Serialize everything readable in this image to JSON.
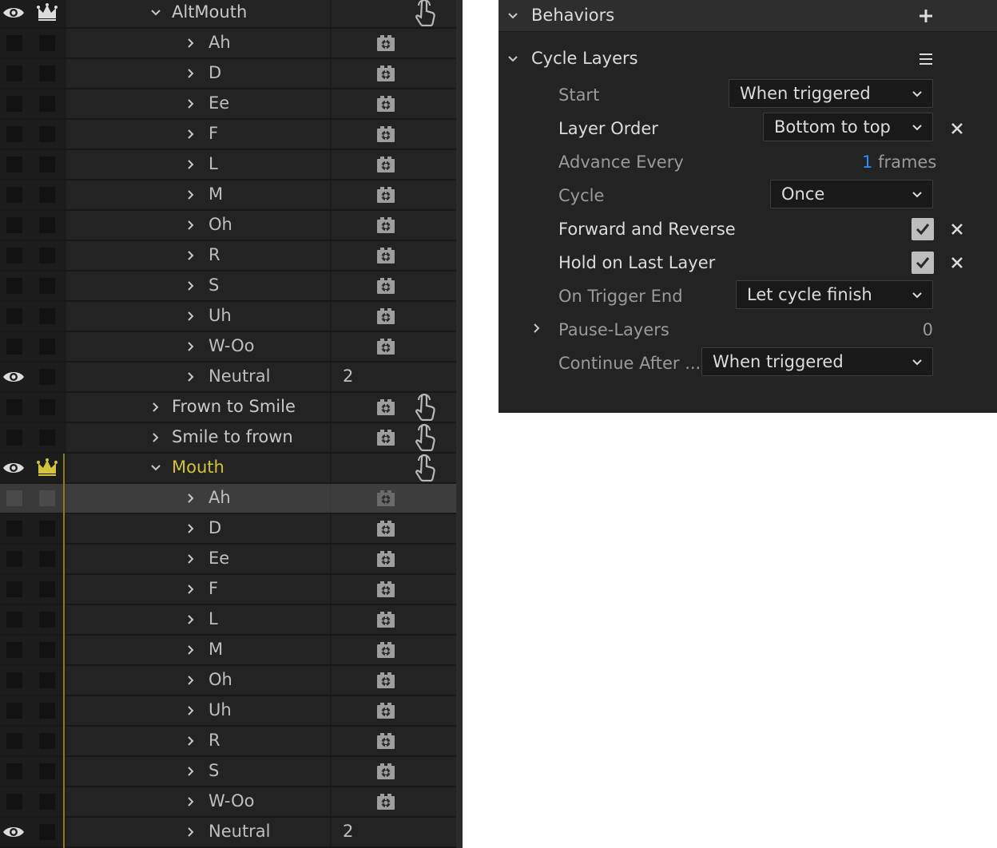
{
  "layers_panel": {
    "rows": [
      {
        "name": "AltMouth",
        "indent": 1,
        "expanded": true,
        "eye": true,
        "crown": true,
        "crown_gold": false,
        "gold": false,
        "cam": false,
        "hand": true
      },
      {
        "name": "Ah",
        "indent": 2,
        "cam": true
      },
      {
        "name": "D",
        "indent": 2,
        "cam": true
      },
      {
        "name": "Ee",
        "indent": 2,
        "cam": true
      },
      {
        "name": "F",
        "indent": 2,
        "cam": true
      },
      {
        "name": "L",
        "indent": 2,
        "cam": true
      },
      {
        "name": "M",
        "indent": 2,
        "cam": true
      },
      {
        "name": "Oh",
        "indent": 2,
        "cam": true
      },
      {
        "name": "R",
        "indent": 2,
        "cam": true
      },
      {
        "name": "S",
        "indent": 2,
        "cam": true
      },
      {
        "name": "Uh",
        "indent": 2,
        "cam": true
      },
      {
        "name": "W-Oo",
        "indent": 2,
        "cam": true
      },
      {
        "name": "Neutral",
        "indent": 2,
        "eye": true,
        "cam": false,
        "param": "2"
      },
      {
        "name": "Frown to Smile",
        "indent": 1,
        "cam": true,
        "hand": true
      },
      {
        "name": "Smile to frown",
        "indent": 1,
        "cam": true,
        "hand": true
      },
      {
        "name": "Mouth",
        "indent": 1,
        "expanded": true,
        "eye": true,
        "crown": true,
        "crown_gold": true,
        "gold": true,
        "cam": false,
        "hand": true,
        "goldline": true
      },
      {
        "name": "Ah",
        "indent": 2,
        "cam": true,
        "selected": true,
        "goldline": true
      },
      {
        "name": "D",
        "indent": 2,
        "cam": true,
        "goldline": true
      },
      {
        "name": "Ee",
        "indent": 2,
        "cam": true,
        "goldline": true
      },
      {
        "name": "F",
        "indent": 2,
        "cam": true,
        "goldline": true
      },
      {
        "name": "L",
        "indent": 2,
        "cam": true,
        "goldline": true
      },
      {
        "name": "M",
        "indent": 2,
        "cam": true,
        "goldline": true
      },
      {
        "name": "Oh",
        "indent": 2,
        "cam": true,
        "goldline": true
      },
      {
        "name": "Uh",
        "indent": 2,
        "cam": true,
        "goldline": true
      },
      {
        "name": "R",
        "indent": 2,
        "cam": true,
        "goldline": true
      },
      {
        "name": "S",
        "indent": 2,
        "cam": true,
        "goldline": true
      },
      {
        "name": "W-Oo",
        "indent": 2,
        "cam": true,
        "goldline": true
      },
      {
        "name": "Neutral",
        "indent": 2,
        "eye": true,
        "cam": false,
        "param": "2",
        "goldline": true
      }
    ]
  },
  "behaviors": {
    "title": "Behaviors",
    "add_icon": "plus-icon",
    "cycle_layers": {
      "title": "Cycle Layers",
      "menu_icon": "hamburger-menu-icon",
      "start_label": "Start",
      "start_value": "When triggered",
      "layer_order_label": "Layer Order",
      "layer_order_value": "Bottom to top",
      "advance_label": "Advance Every",
      "advance_value": "1",
      "advance_unit": "frames",
      "cycle_label": "Cycle",
      "cycle_value": "Once",
      "forward_reverse_label": "Forward and Reverse",
      "forward_reverse_checked": true,
      "hold_label": "Hold on Last Layer",
      "hold_checked": true,
      "trigger_end_label": "On Trigger End",
      "trigger_end_value": "Let cycle finish",
      "pause_label": "Pause-Layers",
      "pause_value": "0",
      "continue_label": "Continue After ...",
      "continue_value": "When triggered"
    }
  },
  "colors": {
    "accent_gold": "#d4c23a",
    "link_blue": "#2f8cff",
    "panel_bg": "#232323"
  }
}
